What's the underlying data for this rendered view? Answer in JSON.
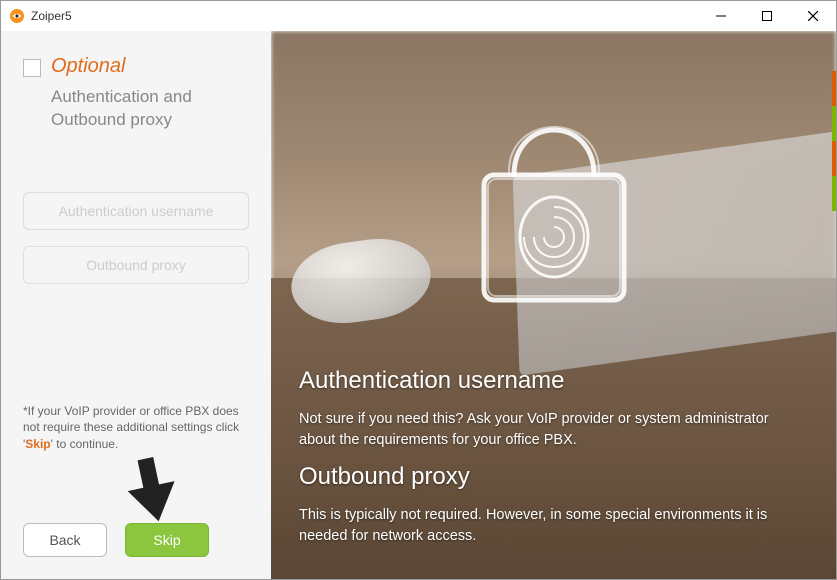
{
  "titlebar": {
    "title": "Zoiper5"
  },
  "left": {
    "optional_label": "Optional",
    "subtitle": "Authentication and Outbound proxy",
    "inputs": {
      "auth_placeholder": "Authentication username",
      "proxy_placeholder": "Outbound proxy"
    },
    "helper_before": "*If your VoIP provider or office PBX does not require these additional settings click '",
    "helper_skip": "Skip",
    "helper_after": "' to continue.",
    "back_label": "Back",
    "skip_label": "Skip"
  },
  "right": {
    "h_auth": "Authentication username",
    "p_auth": " Not sure if you need this? Ask your VoIP provider or system administrator about the requirements for your office PBX.",
    "h_proxy": "Outbound proxy",
    "p_proxy": " This is typically not required. However, in some special environments it is needed for network access."
  },
  "accent_colors": [
    "#e05a00",
    "#7ab800",
    "#e05a00",
    "#7ab800"
  ]
}
